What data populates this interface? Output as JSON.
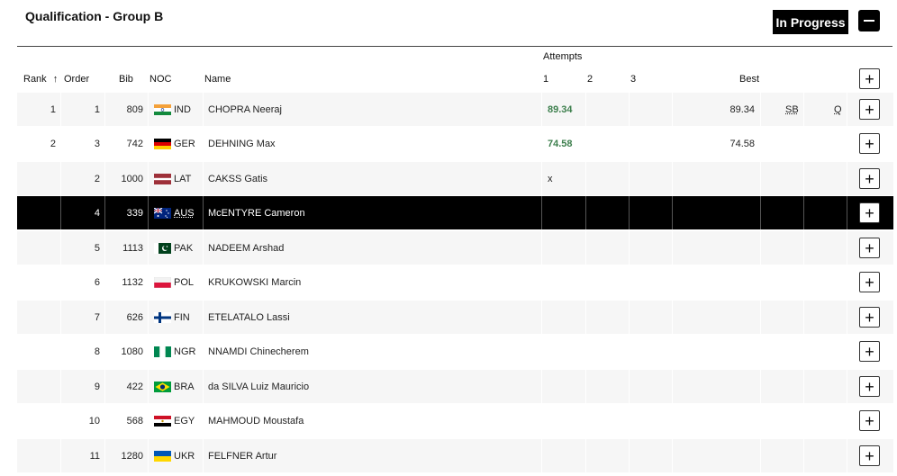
{
  "header": {
    "title": "Qualification - Group B",
    "status": "In Progress"
  },
  "columns": {
    "rank": "Rank",
    "rank_sort": "↑",
    "order": "Order",
    "bib": "Bib",
    "noc": "NOC",
    "name": "Name",
    "attempts": "Attempts",
    "att1": "1",
    "att2": "2",
    "att3": "3",
    "best": "Best"
  },
  "rows": [
    {
      "rank": "1",
      "order": "1",
      "bib": "809",
      "noc": "IND",
      "name": "CHOPRA Neeraj",
      "a1": "89.34",
      "a2": "",
      "a3": "",
      "best": "89.34",
      "rec": "SB",
      "q": "Q"
    },
    {
      "rank": "2",
      "order": "3",
      "bib": "742",
      "noc": "GER",
      "name": "DEHNING Max",
      "a1": "74.58",
      "a2": "",
      "a3": "",
      "best": "74.58",
      "rec": "",
      "q": ""
    },
    {
      "rank": "",
      "order": "2",
      "bib": "1000",
      "noc": "LAT",
      "name": "CAKSS Gatis",
      "a1": "x",
      "a2": "",
      "a3": "",
      "best": "",
      "rec": "",
      "q": ""
    },
    {
      "rank": "",
      "order": "4",
      "bib": "339",
      "noc": "AUS",
      "name": "McENTYRE Cameron",
      "a1": "",
      "a2": "",
      "a3": "",
      "best": "",
      "rec": "",
      "q": ""
    },
    {
      "rank": "",
      "order": "5",
      "bib": "1113",
      "noc": "PAK",
      "name": "NADEEM Arshad",
      "a1": "",
      "a2": "",
      "a3": "",
      "best": "",
      "rec": "",
      "q": ""
    },
    {
      "rank": "",
      "order": "6",
      "bib": "1132",
      "noc": "POL",
      "name": "KRUKOWSKI Marcin",
      "a1": "",
      "a2": "",
      "a3": "",
      "best": "",
      "rec": "",
      "q": ""
    },
    {
      "rank": "",
      "order": "7",
      "bib": "626",
      "noc": "FIN",
      "name": "ETELATALO Lassi",
      "a1": "",
      "a2": "",
      "a3": "",
      "best": "",
      "rec": "",
      "q": ""
    },
    {
      "rank": "",
      "order": "8",
      "bib": "1080",
      "noc": "NGR",
      "name": "NNAMDI Chinecherem",
      "a1": "",
      "a2": "",
      "a3": "",
      "best": "",
      "rec": "",
      "q": ""
    },
    {
      "rank": "",
      "order": "9",
      "bib": "422",
      "noc": "BRA",
      "name": "da SILVA Luiz Mauricio",
      "a1": "",
      "a2": "",
      "a3": "",
      "best": "",
      "rec": "",
      "q": ""
    },
    {
      "rank": "",
      "order": "10",
      "bib": "568",
      "noc": "EGY",
      "name": "MAHMOUD Moustafa",
      "a1": "",
      "a2": "",
      "a3": "",
      "best": "",
      "rec": "",
      "q": ""
    },
    {
      "rank": "",
      "order": "11",
      "bib": "1280",
      "noc": "UKR",
      "name": "FELFNER Artur",
      "a1": "",
      "a2": "",
      "a3": "",
      "best": "",
      "rec": "",
      "q": ""
    }
  ],
  "highlighted_row": "McENTYRE Cameron",
  "icons": {
    "expand": "plus-icon",
    "collapse": "minus-icon",
    "sort": "arrow-up-icon"
  },
  "colors": {
    "mark_green": "#3d7f4d",
    "highlight": "#000000",
    "row_shade": "#f6f6f6"
  }
}
